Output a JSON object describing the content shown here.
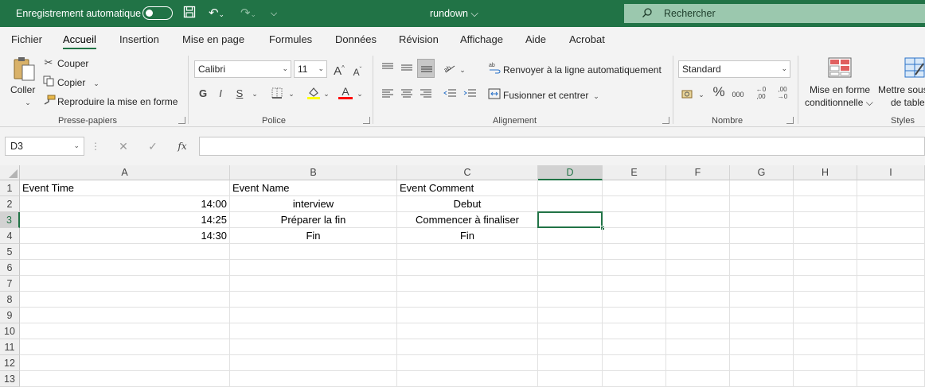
{
  "titlebar": {
    "autosave_label": "Enregistrement automatique",
    "doc_title": "rundown ⌵",
    "search_label": "Rechercher"
  },
  "menu": [
    "Fichier",
    "Accueil",
    "Insertion",
    "Mise en page",
    "Formules",
    "Données",
    "Révision",
    "Affichage",
    "Aide",
    "Acrobat"
  ],
  "ribbon": {
    "clipboard": {
      "paste": "Coller",
      "cut": "Couper",
      "copy": "Copier",
      "format_painter": "Reproduire la mise en forme",
      "group": "Presse-papiers"
    },
    "font": {
      "name": "Calibri",
      "size": "11",
      "bold": "G",
      "italic": "I",
      "underline": "S",
      "group": "Police"
    },
    "alignment": {
      "wrap": "Renvoyer à la ligne automatiquement",
      "merge": "Fusionner et centrer",
      "group": "Alignement"
    },
    "number": {
      "format": "Standard",
      "percent": "%",
      "thousands": "000",
      "group": "Nombre"
    },
    "styles": {
      "conditional_1": "Mise en forme",
      "conditional_2": "conditionnelle ⌵",
      "table_1": "Mettre sous",
      "table_2": "de table",
      "group": "Styles"
    }
  },
  "formula_bar": {
    "name_box": "D3",
    "fx": "fx",
    "value": ""
  },
  "columns": [
    "A",
    "B",
    "C",
    "D",
    "E",
    "F",
    "G",
    "H",
    "I"
  ],
  "rows": [
    "1",
    "2",
    "3",
    "4",
    "5",
    "6",
    "7",
    "8",
    "9",
    "10",
    "11",
    "12",
    "13"
  ],
  "cells": {
    "A1": "Event Time",
    "B1": "Event Name",
    "C1": "Event Comment",
    "A2": "14:00",
    "B2": "interview",
    "C2": "Debut",
    "A3": "14:25",
    "B3": "Préparer la fin",
    "C3": "Commencer à finaliser",
    "A4": "14:30",
    "B4": "Fin",
    "C4": "Fin"
  },
  "selected_cell": "D3"
}
